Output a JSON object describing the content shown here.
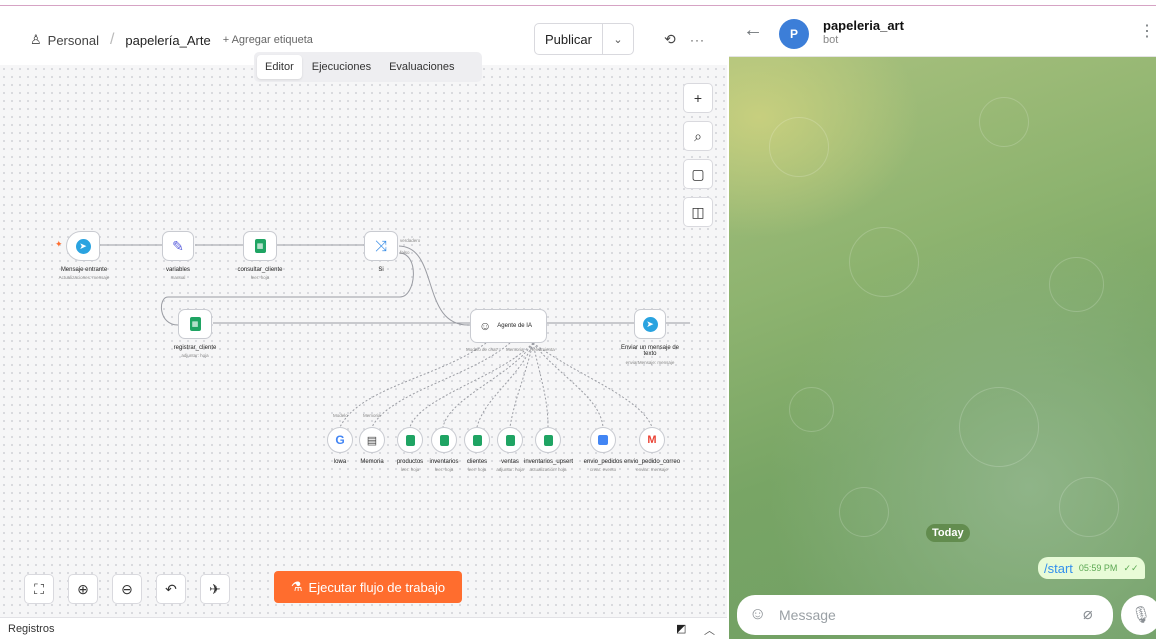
{
  "editor": {
    "breadcrumb": {
      "workspace": "Personal",
      "project": "papelería_Arte",
      "add_tag": "+ Agregar etiqueta"
    },
    "publish": {
      "label": "Publicar"
    },
    "tabs": [
      {
        "label": "Editor",
        "active": true
      },
      {
        "label": "Ejecuciones"
      },
      {
        "label": "Evaluaciones"
      }
    ],
    "run_button": "Ejecutar flujo de trabajo",
    "footer": {
      "label": "Registros"
    },
    "nodes": {
      "trigger": {
        "title": "Mensaje entrante",
        "sub": "Actualizaciones: mensaje"
      },
      "variables": {
        "title": "variables",
        "sub": "manual"
      },
      "consultar": {
        "title": "consultar_cliente",
        "sub": "leer: hoja"
      },
      "si": {
        "title": "Si",
        "out_true": "verdadero",
        "out_false": "falso"
      },
      "registrar": {
        "title": "registrar_cliente",
        "sub": "adjuntar: hoja"
      },
      "agente": {
        "title": "Agente de IA",
        "port1": "Modelo de chat*",
        "port2": "Memoria",
        "port3": "Herramienta"
      },
      "enviar": {
        "title": "Enviar un mensaje de texto",
        "sub": "enviarMensaje: mensaje"
      },
      "tools": [
        {
          "label": "lowa",
          "top": "Modelo",
          "icon": "G"
        },
        {
          "label": "Memoria",
          "top": "Memoria",
          "icon": "▤"
        },
        {
          "label": "productos",
          "sub": "leer: hoja"
        },
        {
          "label": "inventarios",
          "sub": "leer: hoja"
        },
        {
          "label": "clientes",
          "sub": "leer: hoja"
        },
        {
          "label": "ventas",
          "sub": "adjuntar: hoja"
        },
        {
          "label": "inventarios_upsert",
          "sub": "actualización: hoja"
        },
        {
          "label": "envio_pedidos",
          "sub": "crear: evento"
        },
        {
          "label": "envio_pedido_correo",
          "sub": "enviar: mensaje"
        }
      ]
    }
  },
  "telegram": {
    "chat_name": "papeleria_art",
    "status": "bot",
    "avatar_letter": "P",
    "date_chip": "Today",
    "message": {
      "text": "/start",
      "time": "05:59 PM"
    },
    "input_placeholder": "Message"
  },
  "colors": {
    "run": "#ff6d2e",
    "telegram_blue": "#3390ec",
    "chat_green": "#8db36f"
  }
}
